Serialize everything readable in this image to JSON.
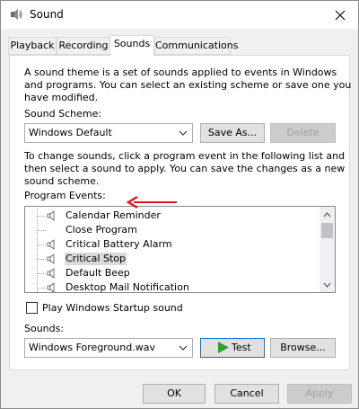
{
  "window": {
    "title": "Sound",
    "icon": "speaker-icon",
    "close_icon": "close-icon"
  },
  "tabs": [
    {
      "label": "Playback"
    },
    {
      "label": "Recording"
    },
    {
      "label": "Sounds",
      "active": true
    },
    {
      "label": "Communications"
    }
  ],
  "sounds_tab": {
    "description": [
      "A sound theme is a set of sounds applied to events in Windows",
      "and programs.  You can select an existing scheme or save one you",
      "have modified."
    ],
    "scheme_label": "Sound Scheme:",
    "scheme_value": "Windows Default",
    "save_as_label": "Save As...",
    "delete_label": "Delete",
    "instructions": [
      "To change sounds, click a program event in the following list and",
      "then select a sound to apply.  You can save the changes as a new",
      "sound scheme."
    ],
    "program_events_label": "Program Events:",
    "events": [
      {
        "label": "Calendar Reminder",
        "has_sound": true,
        "selected": false
      },
      {
        "label": "Close Program",
        "has_sound": false,
        "selected": false
      },
      {
        "label": "Critical Battery Alarm",
        "has_sound": true,
        "selected": false
      },
      {
        "label": "Critical Stop",
        "has_sound": true,
        "selected": true
      },
      {
        "label": "Default Beep",
        "has_sound": true,
        "selected": false
      },
      {
        "label": "Desktop Mail Notification",
        "has_sound": true,
        "selected": false
      }
    ],
    "startup_sound_label": "Play Windows Startup sound",
    "startup_sound_checked": false,
    "sounds_label": "Sounds:",
    "sound_value": "Windows Foreground.wav",
    "test_label": "Test",
    "browse_label": "Browse..."
  },
  "footer": {
    "ok_label": "OK",
    "cancel_label": "Cancel",
    "apply_label": "Apply"
  },
  "colors": {
    "accent": "#0078d7",
    "annotation_arrow": "#e81123",
    "test_play": "#2aa52a",
    "disabled_text": "#a0a0a0"
  }
}
